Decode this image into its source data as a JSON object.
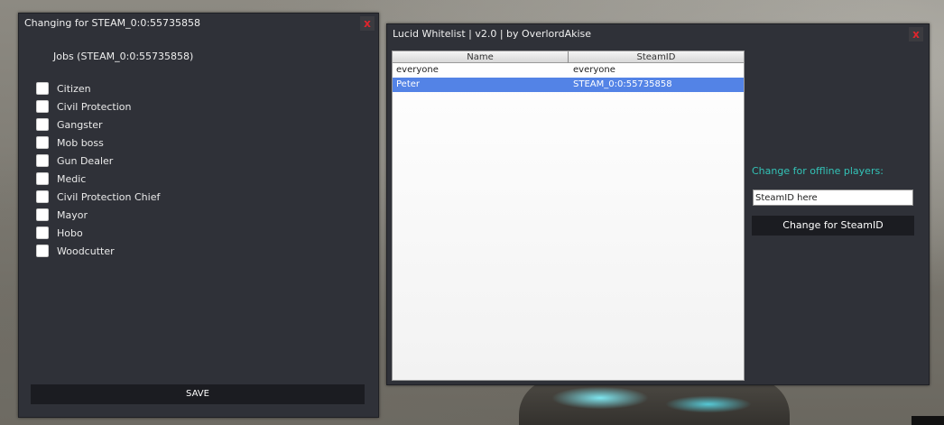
{
  "jobs_panel": {
    "title": "Changing for STEAM_0:0:55735858",
    "close_label": "x",
    "jobs_header": "Jobs (STEAM_0:0:55735858)",
    "jobs": [
      {
        "label": "Citizen",
        "checked": false
      },
      {
        "label": "Civil Protection",
        "checked": false
      },
      {
        "label": "Gangster",
        "checked": false
      },
      {
        "label": "Mob boss",
        "checked": false
      },
      {
        "label": "Gun Dealer",
        "checked": false
      },
      {
        "label": "Medic",
        "checked": false
      },
      {
        "label": "Civil Protection Chief",
        "checked": false
      },
      {
        "label": "Mayor",
        "checked": false
      },
      {
        "label": "Hobo",
        "checked": false
      },
      {
        "label": "Woodcutter",
        "checked": false
      }
    ],
    "save_label": "SAVE"
  },
  "whitelist_panel": {
    "title": "Lucid Whitelist | v2.0 | by OverlordAkise",
    "close_label": "x",
    "columns": [
      "Name",
      "SteamID"
    ],
    "rows": [
      {
        "name": "everyone",
        "steamid": "everyone",
        "selected": false
      },
      {
        "name": "Peter",
        "steamid": "STEAM_0:0:55735858",
        "selected": true
      }
    ],
    "offline_label": "Change for offline players:",
    "steamid_input": {
      "value": "",
      "placeholder": "SteamID here"
    },
    "change_button_label": "Change for SteamID"
  },
  "colors": {
    "panel_bg": "#2f3138",
    "close_red": "#e0252c",
    "accent_teal": "#33c3b7",
    "selection_blue": "#5383e6",
    "button_dark": "#1b1c21"
  }
}
